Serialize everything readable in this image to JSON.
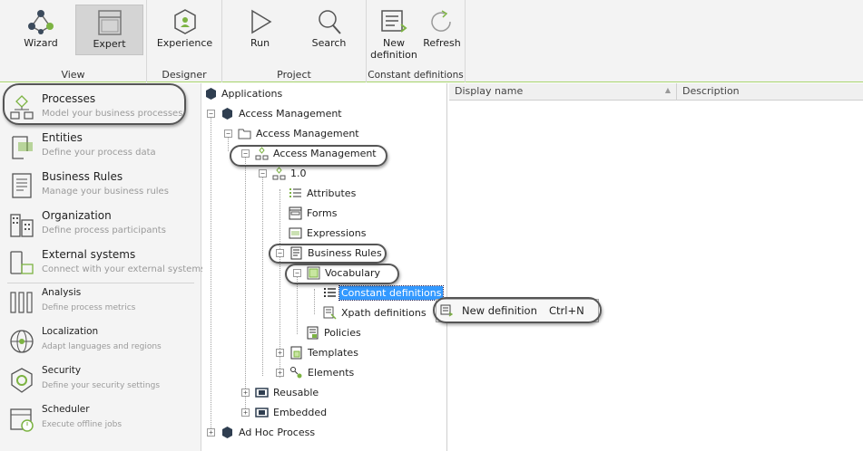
{
  "ribbon": {
    "groups": [
      {
        "label": "View",
        "buttons": [
          {
            "label": "Wizard",
            "icon": "wizard-icon"
          },
          {
            "label": "Expert",
            "icon": "expert-icon",
            "active": true
          }
        ]
      },
      {
        "label": "Designer",
        "buttons": [
          {
            "label": "Experience",
            "icon": "experience-icon"
          }
        ]
      },
      {
        "label": "Project",
        "buttons": [
          {
            "label": "Run",
            "icon": "run-icon"
          },
          {
            "label": "Search",
            "icon": "search-icon"
          }
        ]
      },
      {
        "label": "Constant definitions",
        "buttons": [
          {
            "label": "New definition",
            "icon": "new-definition-icon"
          },
          {
            "label": "Refresh",
            "icon": "refresh-icon"
          }
        ]
      }
    ]
  },
  "leftnav": {
    "items": [
      {
        "title": "Processes",
        "subtitle": "Model your business processes",
        "icon": "processes-icon"
      },
      {
        "title": "Entities",
        "subtitle": "Define your process data",
        "icon": "entities-icon"
      },
      {
        "title": "Business Rules",
        "subtitle": "Manage your business rules",
        "icon": "business-rules-icon"
      },
      {
        "title": "Organization",
        "subtitle": "Define process participants",
        "icon": "organization-icon"
      },
      {
        "title": "External systems",
        "subtitle": "Connect with your external systems",
        "icon": "external-systems-icon"
      },
      {
        "title": "Analysis",
        "subtitle": "Define process metrics",
        "icon": "analysis-icon"
      },
      {
        "title": "Localization",
        "subtitle": "Adapt languages and regions",
        "icon": "localization-icon"
      },
      {
        "title": "Security",
        "subtitle": "Define your security settings",
        "icon": "security-icon"
      },
      {
        "title": "Scheduler",
        "subtitle": "Execute offline jobs",
        "icon": "scheduler-icon"
      }
    ]
  },
  "tree": {
    "nodes": [
      {
        "label": "Applications"
      },
      {
        "label": "Access Management",
        "expander": "−"
      },
      {
        "label": "Access Management",
        "expander": "−"
      },
      {
        "label": "Access Management",
        "expander": "−"
      },
      {
        "label": "1.0",
        "expander": "−"
      },
      {
        "label": "Attributes"
      },
      {
        "label": "Forms"
      },
      {
        "label": "Expressions"
      },
      {
        "label": "Business Rules",
        "expander": "−"
      },
      {
        "label": "Vocabulary",
        "expander": "−"
      },
      {
        "label": "Constant definitions",
        "selected": true
      },
      {
        "label": "Xpath definitions"
      },
      {
        "label": "Policies"
      },
      {
        "label": "Templates",
        "expander": "+"
      },
      {
        "label": "Elements",
        "expander": "+"
      },
      {
        "label": "Reusable",
        "expander": "+"
      },
      {
        "label": "Embedded",
        "expander": "+"
      },
      {
        "label": "Ad Hoc Process",
        "expander": "+"
      }
    ]
  },
  "grid": {
    "columns": [
      "Display name",
      "Description"
    ]
  },
  "context_menu": {
    "item_label": "New definition",
    "shortcut": "Ctrl+N"
  }
}
